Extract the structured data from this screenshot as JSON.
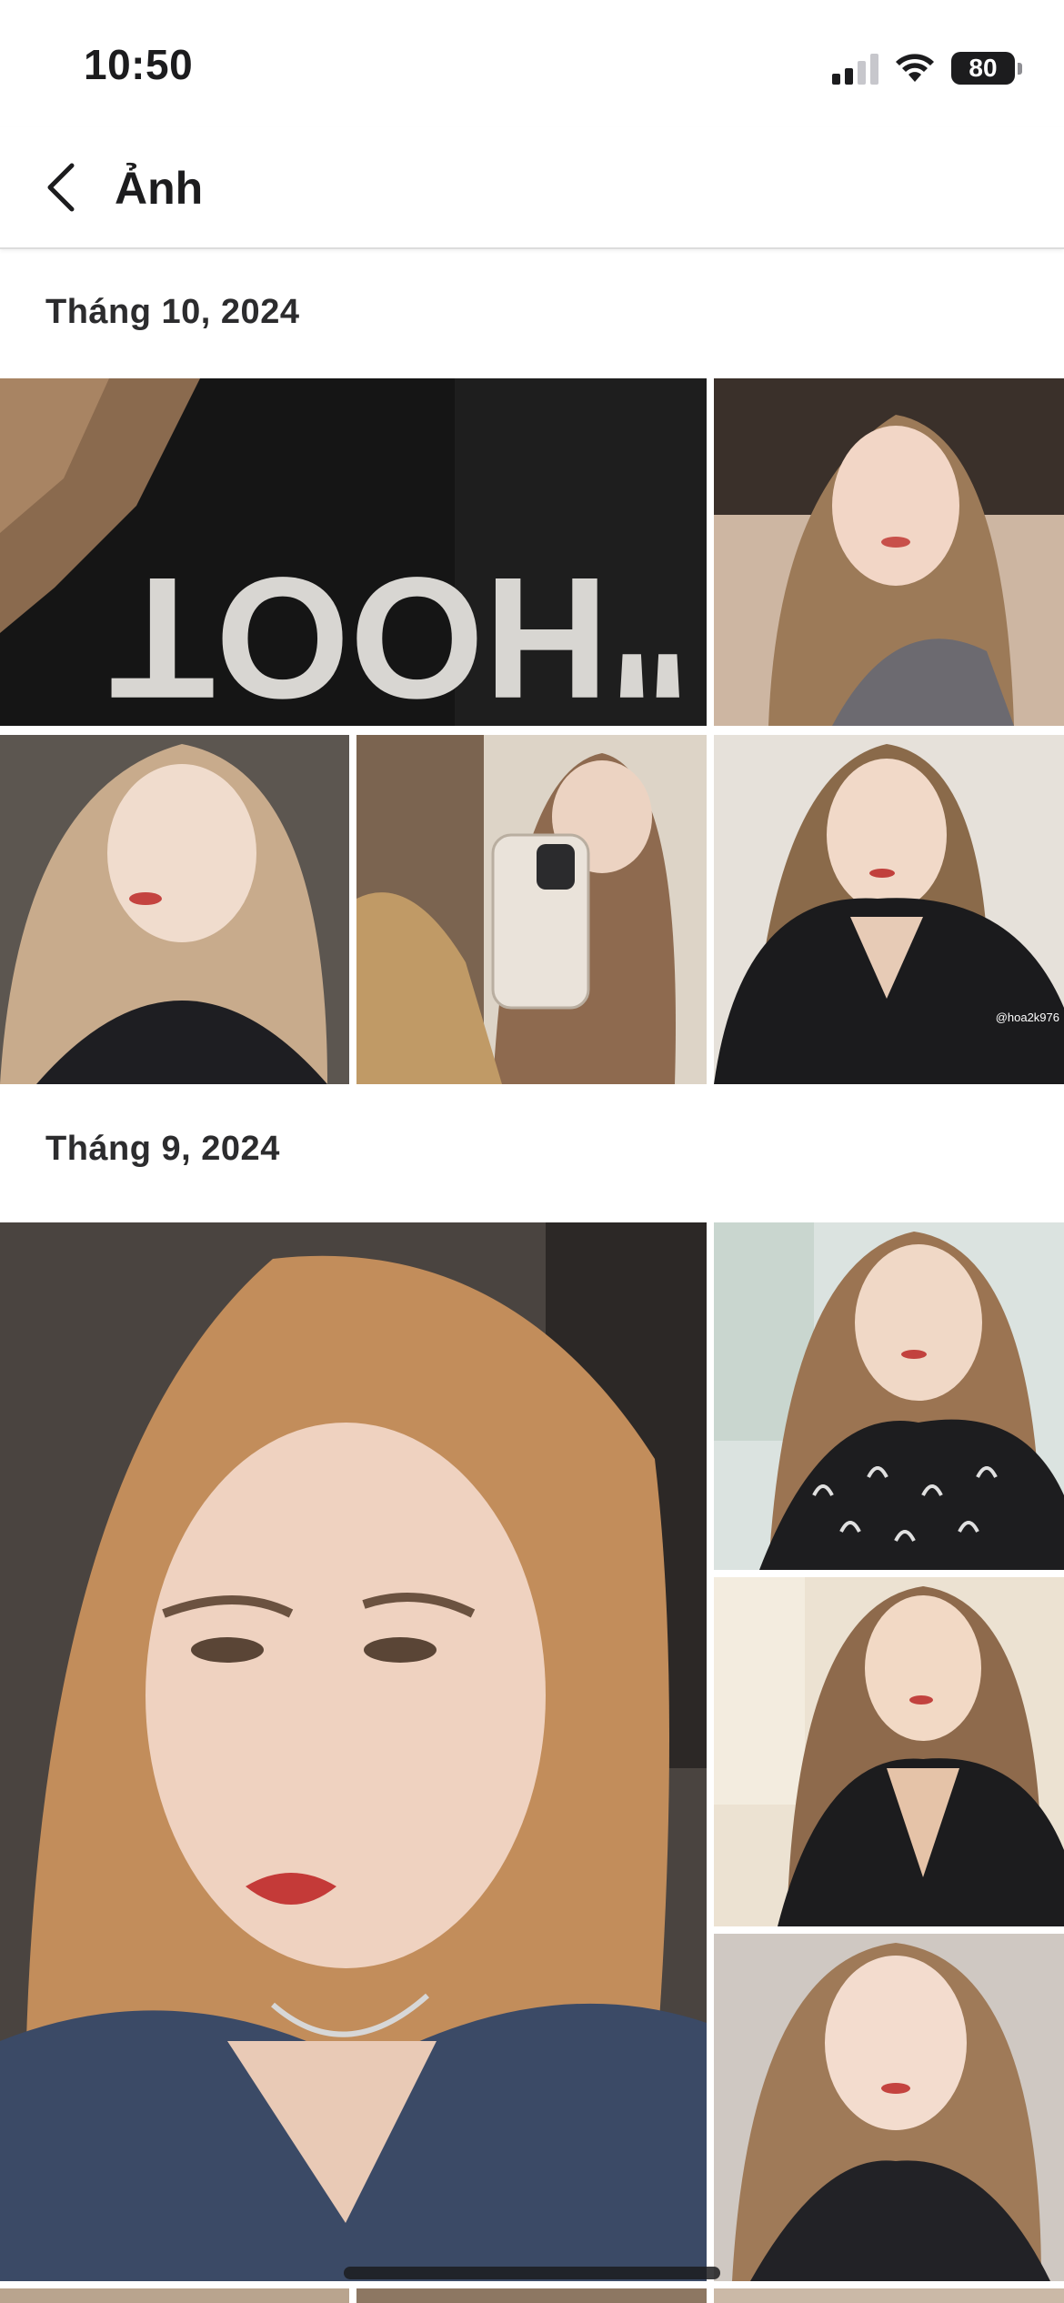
{
  "status_bar": {
    "time": "10:50",
    "battery": "80",
    "icons": [
      "cellular-signal-icon",
      "wifi-icon",
      "battery-icon"
    ]
  },
  "nav": {
    "title": "Ảnh",
    "back_icon": "chevron-left-icon"
  },
  "sections": [
    {
      "title": "Tháng 10, 2024",
      "photos": [
        {
          "name": "photo-black-shirt-print",
          "colors": [
            "#2a2a2a",
            "#0e0e0e",
            "#3b3b3b"
          ],
          "overlay_text": "\"HOOT"
        },
        {
          "name": "photo-selfie-1",
          "colors": [
            "#d9c2b0",
            "#6d5a50",
            "#b8a28f"
          ]
        },
        {
          "name": "photo-selfie-2",
          "colors": [
            "#e8d8c8",
            "#2a2a2e",
            "#c9a98a"
          ]
        },
        {
          "name": "photo-mirror-selfie",
          "colors": [
            "#c8b9a6",
            "#3a3028",
            "#e9e1d6"
          ]
        },
        {
          "name": "photo-selfie-3",
          "colors": [
            "#e6e2dc",
            "#1b1b1d",
            "#d7c2ad"
          ],
          "watermark": "@hoa2k976"
        }
      ]
    },
    {
      "title": "Tháng 9, 2024",
      "photos": [
        {
          "name": "photo-selfie-large",
          "colors": [
            "#c49a6c",
            "#3b4a66",
            "#e7c4aa"
          ]
        },
        {
          "name": "photo-selfie-4",
          "colors": [
            "#e2d6cc",
            "#1d1d1f",
            "#c8a78a"
          ]
        },
        {
          "name": "photo-selfie-5",
          "colors": [
            "#e8dccc",
            "#1c1c1e",
            "#cfa888"
          ]
        },
        {
          "name": "photo-selfie-6",
          "colors": [
            "#e8e2dc",
            "#222226",
            "#d2b296"
          ]
        }
      ]
    }
  ]
}
